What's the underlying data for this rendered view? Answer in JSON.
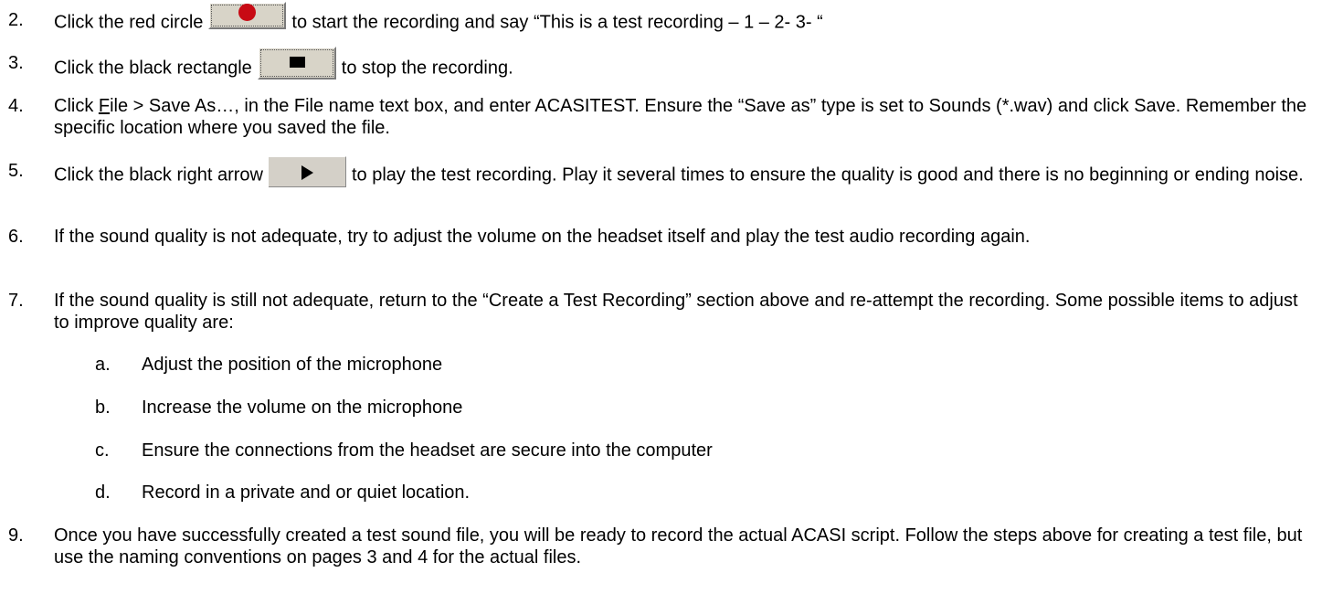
{
  "steps": [
    {
      "num": "2.",
      "before": "Click the red circle",
      "icon": "record-icon",
      "after": "to start the recording and say “This is a test recording – 1 – 2- 3- “"
    },
    {
      "num": "3.",
      "before": "Click the black rectangle",
      "icon": "stop-icon",
      "after": "to stop the recording."
    },
    {
      "num": "4.",
      "part1": "Click ",
      "file_accel": "F",
      "part2": "ile > Save As…, in the File name text box, and enter ACASITEST. Ensure the “Save as” type is set to Sounds (*.wav) and click Save.  Remember the specific location where you saved the file."
    },
    {
      "num": "5.",
      "before": "Click the black right arrow",
      "icon": "play-icon",
      "after": "to play the test recording.  Play it several times to ensure the quality is good and there is no beginning or ending noise."
    },
    {
      "num": "6.",
      "text": "If the sound quality is not adequate, try to adjust the volume on the headset itself and play the test audio recording again."
    },
    {
      "num": "7.",
      "text": "If the sound quality is still not adequate, return to the “Create a Test Recording” section above and re-attempt the recording.  Some possible items to adjust to improve quality are:"
    },
    {
      "num": "9.",
      "text": "Once you have successfully created a test sound file, you will be ready to record the actual ACASI script. Follow the steps above for creating a test file, but use the naming conventions on pages 3 and 4 for the actual files."
    }
  ],
  "substeps": [
    {
      "letter": "a.",
      "text": "Adjust the position of the microphone"
    },
    {
      "letter": "b.",
      "text": "Increase the volume on the microphone"
    },
    {
      "letter": "c.",
      "text": "Ensure the connections from the headset are secure into the computer"
    },
    {
      "letter": "d.",
      "text": "Record in a private and or quiet location."
    }
  ],
  "colors": {
    "record_dot": "#c80a14",
    "button_face": "#d4d0c8"
  }
}
